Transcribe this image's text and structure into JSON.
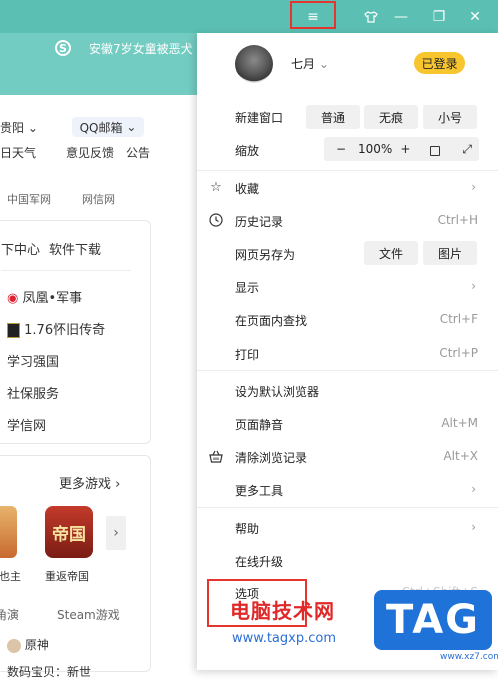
{
  "titlebar": {
    "menu_icon": "≡",
    "skin_icon": "tshirt-icon",
    "min_icon": "—",
    "max_icon": "❐",
    "close_icon": "✕"
  },
  "address": {
    "news": "安徽7岁女童被恶犬"
  },
  "page": {
    "city": "贵阳",
    "weather": "日天气",
    "feedback": "意见反馈",
    "announce": "公告",
    "qq_mail": "QQ邮箱",
    "links": [
      "中国军网",
      "网信网"
    ],
    "card1": {
      "tabs": [
        "下中心",
        "软件下载"
      ],
      "items": [
        "凤凰•军事",
        "1.76怀旧传奇",
        "学习强国",
        "社保服务",
        "学信网"
      ]
    },
    "games": {
      "more": "更多游戏",
      "game1": "重返帝国",
      "game1_logo": "帝国",
      "game0_part": "也主",
      "row1": [
        "角演",
        "Steam游戏"
      ],
      "genshin": "原神",
      "bottom": "数码宝贝：新世"
    }
  },
  "menu": {
    "user_name": "七月",
    "login_badge": "已登录",
    "new_window": {
      "label": "新建窗口",
      "normal": "普通",
      "incognito": "无痕",
      "small": "小号"
    },
    "zoom": {
      "label": "缩放",
      "minus": "−",
      "value": "100%",
      "plus": "+"
    },
    "favorites": "收藏",
    "history": {
      "label": "历史记录",
      "shortcut": "Ctrl+H"
    },
    "save_as": {
      "label": "网页另存为",
      "file": "文件",
      "image": "图片"
    },
    "show": "显示",
    "find": {
      "label": "在页面内查找",
      "shortcut": "Ctrl+F"
    },
    "print": {
      "label": "打印",
      "shortcut": "Ctrl+P"
    },
    "default_browser": "设为默认浏览器",
    "mute": {
      "label": "页面静音",
      "shortcut": "Alt+M"
    },
    "clear": {
      "label": "清除浏览记录",
      "shortcut": "Alt+X"
    },
    "more_tools": "更多工具",
    "help": "帮助",
    "update": "在线升级",
    "options": {
      "label": "选项",
      "shortcut": "Ctrl+Shift+S"
    }
  },
  "watermark": {
    "site_name": "电脑技术网",
    "url": "www.tagxp.com",
    "tag": "TAG",
    "small": "www.xz7.com"
  },
  "colors": {
    "header": "#5bbfb3",
    "highlight": "#e5352f",
    "login": "#f7c52e",
    "tag": "#1f72d8"
  }
}
